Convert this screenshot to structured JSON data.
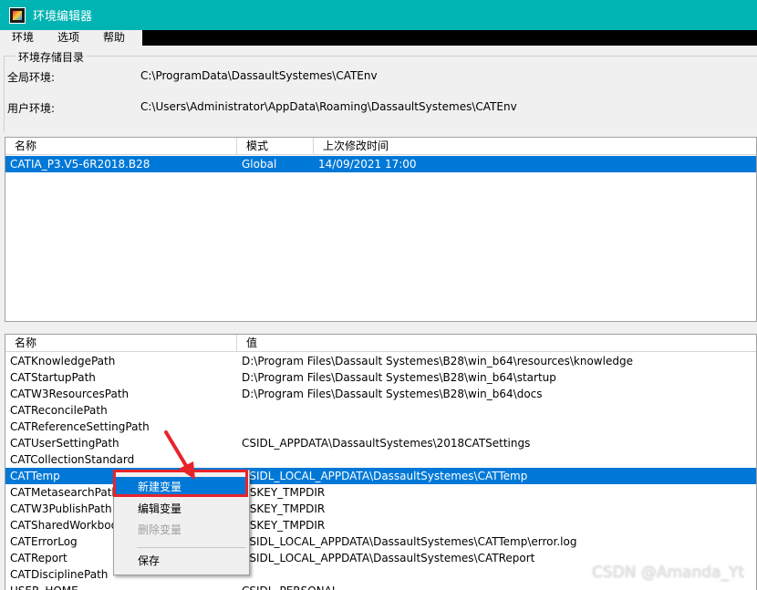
{
  "window": {
    "title": "环境编辑器"
  },
  "menu": {
    "items": [
      "环境",
      "选项",
      "帮助"
    ]
  },
  "storage": {
    "legend": "环境存储目录",
    "global_label": "全局环境:",
    "global_path": "C:\\ProgramData\\DassaultSystemes\\CATEnv",
    "user_label": "用户环境:",
    "user_path": "C:\\Users\\Administrator\\AppData\\Roaming\\DassaultSystemes\\CATEnv"
  },
  "env_list": {
    "headers": [
      "名称",
      "模式",
      "上次修改时间"
    ],
    "rows": [
      {
        "name": "CATIA_P3.V5-6R2018.B28",
        "mode": "Global",
        "modified": "14/09/2021   17:00"
      }
    ]
  },
  "var_list": {
    "headers": [
      "名称",
      "值"
    ],
    "rows": [
      {
        "name": "CATKnowledgePath",
        "value": "D:\\Program Files\\Dassault Systemes\\B28\\win_b64\\resources\\knowledge"
      },
      {
        "name": "CATStartupPath",
        "value": "D:\\Program Files\\Dassault Systemes\\B28\\win_b64\\startup"
      },
      {
        "name": "CATW3ResourcesPath",
        "value": "D:\\Program Files\\Dassault Systemes\\B28\\win_b64\\docs"
      },
      {
        "name": "CATReconcilePath",
        "value": ""
      },
      {
        "name": "CATReferenceSettingPath",
        "value": ""
      },
      {
        "name": "CATUserSettingPath",
        "value": "CSIDL_APPDATA\\DassaultSystemes\\2018CATSettings"
      },
      {
        "name": "CATCollectionStandard",
        "value": ""
      },
      {
        "name": "CATTemp",
        "value": "CSIDL_LOCAL_APPDATA\\DassaultSystemes\\CATTemp"
      },
      {
        "name": "CATMetasearchPath",
        "value": "USKEY_TMPDIR"
      },
      {
        "name": "CATW3PublishPath",
        "value": "USKEY_TMPDIR"
      },
      {
        "name": "CATSharedWorkbookPath",
        "value": "USKEY_TMPDIR"
      },
      {
        "name": "CATErrorLog",
        "value": "CSIDL_LOCAL_APPDATA\\DassaultSystemes\\CATTemp\\error.log"
      },
      {
        "name": "CATReport",
        "value": "CSIDL_LOCAL_APPDATA\\DassaultSystemes\\CATReport"
      },
      {
        "name": "CATDisciplinePath",
        "value": ""
      },
      {
        "name": "USER_HOME",
        "value": "CSIDL_PERSONAL"
      }
    ]
  },
  "context_menu": {
    "new_var": "新建变量",
    "edit_var": "编辑变量",
    "delete_var": "删除变量",
    "save": "保存"
  },
  "watermark": "CSDN @Amanda_Yt",
  "colors": {
    "titlebar": "#00b4b4",
    "selection": "#0078d7",
    "highlight_box": "#e8242b"
  }
}
